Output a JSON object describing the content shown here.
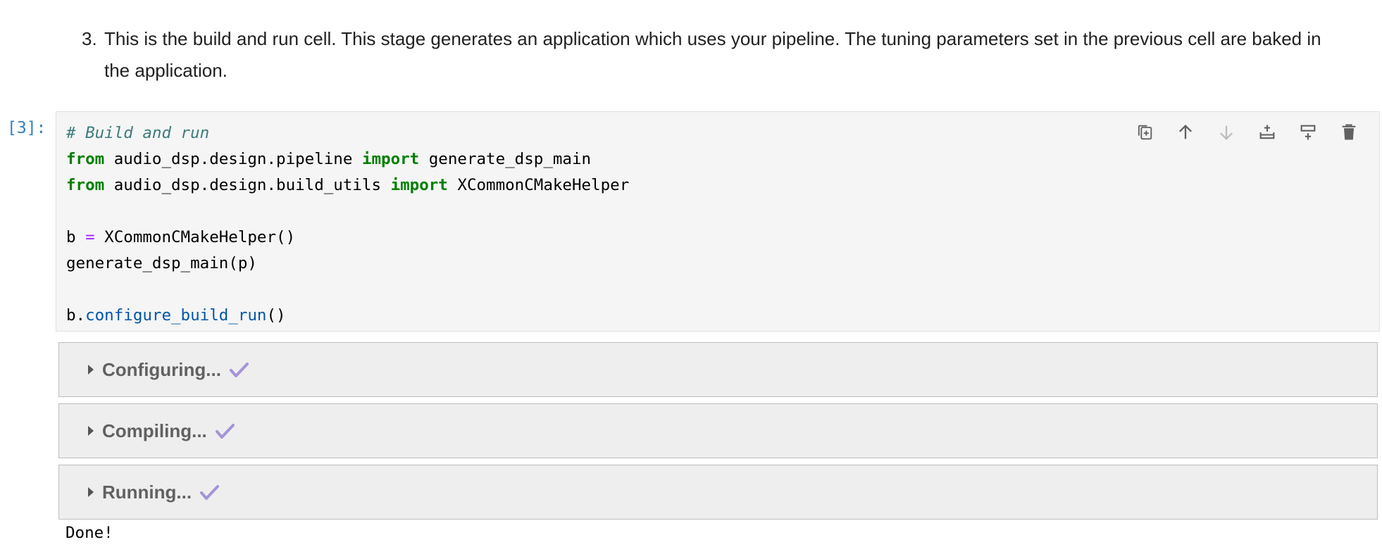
{
  "markdown": {
    "list_number": "3.",
    "text": "This is the build and run cell. This stage generates an application which uses your pipeline. The tuning parameters set in the previous cell are baked in the application."
  },
  "cell": {
    "prompt": "[3]:",
    "code": {
      "line1_comment": "# Build and run",
      "line2_from": "from",
      "line2_module": " audio_dsp.design.pipeline ",
      "line2_import": "import",
      "line2_name": " generate_dsp_main",
      "line3_from": "from",
      "line3_module": " audio_dsp.design.build_utils ",
      "line3_import": "import",
      "line3_name": " XCommonCMakeHelper",
      "line5_var": "b ",
      "line5_op": "=",
      "line5_rest": " XCommonCMakeHelper()",
      "line6": "generate_dsp_main(p)",
      "line8_obj": "b.",
      "line8_method": "configure_build_run",
      "line8_parens": "()"
    },
    "toolbar": [
      {
        "icon": "duplicate-icon",
        "title": "Duplicate"
      },
      {
        "icon": "arrow-up-icon",
        "title": "Move up"
      },
      {
        "icon": "arrow-down-icon",
        "title": "Move down"
      },
      {
        "icon": "insert-above-icon",
        "title": "Insert above"
      },
      {
        "icon": "insert-below-icon",
        "title": "Insert below"
      },
      {
        "icon": "trash-icon",
        "title": "Delete"
      }
    ]
  },
  "outputs": {
    "accordions": [
      {
        "label": "Configuring...",
        "status_icon": "check-icon"
      },
      {
        "label": "Compiling...",
        "status_icon": "check-icon"
      },
      {
        "label": "Running...",
        "status_icon": "check-icon"
      }
    ],
    "done_text": "Done!"
  },
  "colors": {
    "prompt": "#307fc1",
    "keyword": "#008000",
    "comment": "#3d7b7b",
    "operator": "#aa22ff",
    "method": "#0055aa",
    "check": "#a593d6",
    "icon": "#616161",
    "icon_disabled": "#bdbdbd"
  }
}
